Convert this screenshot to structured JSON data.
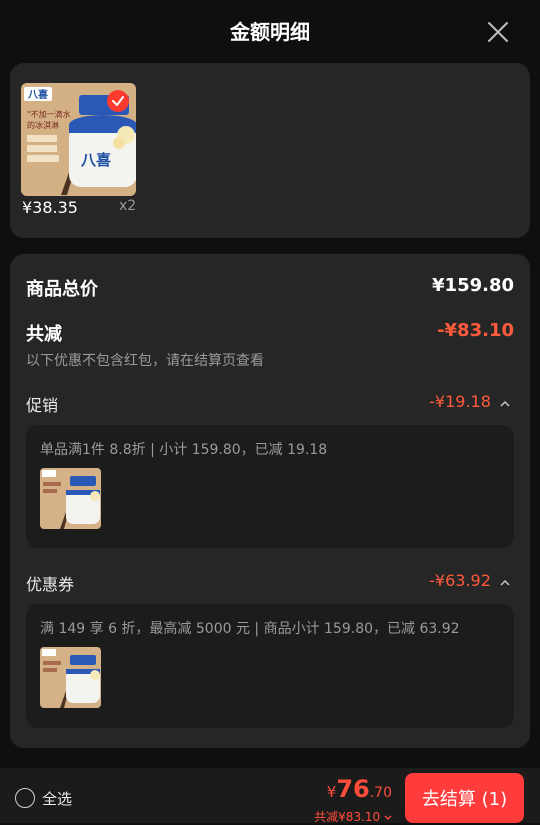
{
  "header": {
    "title": "金额明细"
  },
  "product": {
    "price": "¥38.35",
    "quantity": "x2",
    "brand": "八喜",
    "image_text": "\"不加一滴水\"的冰淇淋",
    "features": [
      "生牛乳",
      "香草清香",
      "10种口味"
    ]
  },
  "summary": {
    "subtotal_label": "商品总价",
    "subtotal_value": "¥159.80",
    "discount_label": "共减",
    "discount_value": "-¥83.10",
    "note": "以下优惠不包含红包，请在结算页查看"
  },
  "promotion": {
    "label": "促销",
    "amount": "-¥19.18",
    "detail": "单品满1件 8.8折 | 小计 159.80，已减 19.18"
  },
  "coupon": {
    "label": "优惠券",
    "amount": "-¥63.92",
    "detail": "满 149 享 6 折，最高减 5000 元 | 商品小计 159.80，已减 63.92"
  },
  "footer": {
    "select_all": "全选",
    "total_currency": "¥",
    "total_integer": "76",
    "total_decimal": ".70",
    "total_saving": "共减¥83.10",
    "checkout_label": "去结算 (1)"
  },
  "colors": {
    "accent_red": "#ff3b3b",
    "discount_red": "#ff5a3c",
    "card_bg": "#262626",
    "page_bg": "#0f0f0f"
  }
}
